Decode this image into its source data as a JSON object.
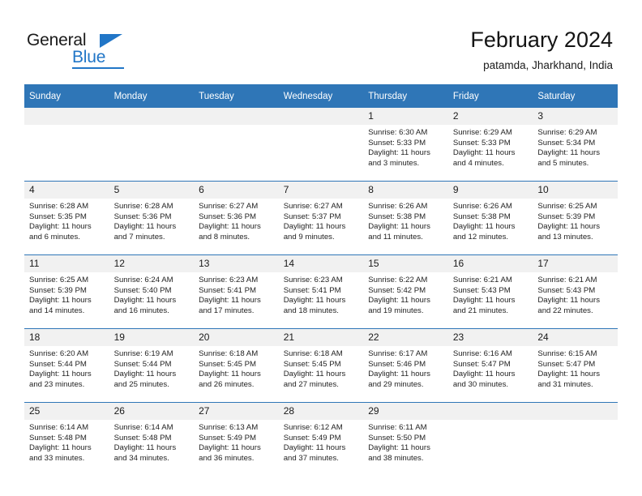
{
  "brand": {
    "name_top": "General",
    "name_bottom": "Blue",
    "accent_color": "#2176c7"
  },
  "header": {
    "title": "February 2024",
    "subtitle": "patamda, Jharkhand, India"
  },
  "theme": {
    "header_blue": "#2f76b7",
    "daynum_band": "#f1f1f1",
    "text": "#232323"
  },
  "weekday_headers": [
    "Sunday",
    "Monday",
    "Tuesday",
    "Wednesday",
    "Thursday",
    "Friday",
    "Saturday"
  ],
  "labels": {
    "sunrise_prefix": "Sunrise:",
    "sunset_prefix": "Sunset:",
    "daylight_prefix": "Daylight:"
  },
  "weeks": [
    [
      {
        "day": "",
        "lines": [
          "",
          "",
          "",
          ""
        ]
      },
      {
        "day": "",
        "lines": [
          "",
          "",
          "",
          ""
        ]
      },
      {
        "day": "",
        "lines": [
          "",
          "",
          "",
          ""
        ]
      },
      {
        "day": "",
        "lines": [
          "",
          "",
          "",
          ""
        ]
      },
      {
        "day": "1",
        "lines": [
          "Sunrise: 6:30 AM",
          "Sunset: 5:33 PM",
          "Daylight: 11 hours",
          "and 3 minutes."
        ]
      },
      {
        "day": "2",
        "lines": [
          "Sunrise: 6:29 AM",
          "Sunset: 5:33 PM",
          "Daylight: 11 hours",
          "and 4 minutes."
        ]
      },
      {
        "day": "3",
        "lines": [
          "Sunrise: 6:29 AM",
          "Sunset: 5:34 PM",
          "Daylight: 11 hours",
          "and 5 minutes."
        ]
      }
    ],
    [
      {
        "day": "4",
        "lines": [
          "Sunrise: 6:28 AM",
          "Sunset: 5:35 PM",
          "Daylight: 11 hours",
          "and 6 minutes."
        ]
      },
      {
        "day": "5",
        "lines": [
          "Sunrise: 6:28 AM",
          "Sunset: 5:36 PM",
          "Daylight: 11 hours",
          "and 7 minutes."
        ]
      },
      {
        "day": "6",
        "lines": [
          "Sunrise: 6:27 AM",
          "Sunset: 5:36 PM",
          "Daylight: 11 hours",
          "and 8 minutes."
        ]
      },
      {
        "day": "7",
        "lines": [
          "Sunrise: 6:27 AM",
          "Sunset: 5:37 PM",
          "Daylight: 11 hours",
          "and 9 minutes."
        ]
      },
      {
        "day": "8",
        "lines": [
          "Sunrise: 6:26 AM",
          "Sunset: 5:38 PM",
          "Daylight: 11 hours",
          "and 11 minutes."
        ]
      },
      {
        "day": "9",
        "lines": [
          "Sunrise: 6:26 AM",
          "Sunset: 5:38 PM",
          "Daylight: 11 hours",
          "and 12 minutes."
        ]
      },
      {
        "day": "10",
        "lines": [
          "Sunrise: 6:25 AM",
          "Sunset: 5:39 PM",
          "Daylight: 11 hours",
          "and 13 minutes."
        ]
      }
    ],
    [
      {
        "day": "11",
        "lines": [
          "Sunrise: 6:25 AM",
          "Sunset: 5:39 PM",
          "Daylight: 11 hours",
          "and 14 minutes."
        ]
      },
      {
        "day": "12",
        "lines": [
          "Sunrise: 6:24 AM",
          "Sunset: 5:40 PM",
          "Daylight: 11 hours",
          "and 16 minutes."
        ]
      },
      {
        "day": "13",
        "lines": [
          "Sunrise: 6:23 AM",
          "Sunset: 5:41 PM",
          "Daylight: 11 hours",
          "and 17 minutes."
        ]
      },
      {
        "day": "14",
        "lines": [
          "Sunrise: 6:23 AM",
          "Sunset: 5:41 PM",
          "Daylight: 11 hours",
          "and 18 minutes."
        ]
      },
      {
        "day": "15",
        "lines": [
          "Sunrise: 6:22 AM",
          "Sunset: 5:42 PM",
          "Daylight: 11 hours",
          "and 19 minutes."
        ]
      },
      {
        "day": "16",
        "lines": [
          "Sunrise: 6:21 AM",
          "Sunset: 5:43 PM",
          "Daylight: 11 hours",
          "and 21 minutes."
        ]
      },
      {
        "day": "17",
        "lines": [
          "Sunrise: 6:21 AM",
          "Sunset: 5:43 PM",
          "Daylight: 11 hours",
          "and 22 minutes."
        ]
      }
    ],
    [
      {
        "day": "18",
        "lines": [
          "Sunrise: 6:20 AM",
          "Sunset: 5:44 PM",
          "Daylight: 11 hours",
          "and 23 minutes."
        ]
      },
      {
        "day": "19",
        "lines": [
          "Sunrise: 6:19 AM",
          "Sunset: 5:44 PM",
          "Daylight: 11 hours",
          "and 25 minutes."
        ]
      },
      {
        "day": "20",
        "lines": [
          "Sunrise: 6:18 AM",
          "Sunset: 5:45 PM",
          "Daylight: 11 hours",
          "and 26 minutes."
        ]
      },
      {
        "day": "21",
        "lines": [
          "Sunrise: 6:18 AM",
          "Sunset: 5:45 PM",
          "Daylight: 11 hours",
          "and 27 minutes."
        ]
      },
      {
        "day": "22",
        "lines": [
          "Sunrise: 6:17 AM",
          "Sunset: 5:46 PM",
          "Daylight: 11 hours",
          "and 29 minutes."
        ]
      },
      {
        "day": "23",
        "lines": [
          "Sunrise: 6:16 AM",
          "Sunset: 5:47 PM",
          "Daylight: 11 hours",
          "and 30 minutes."
        ]
      },
      {
        "day": "24",
        "lines": [
          "Sunrise: 6:15 AM",
          "Sunset: 5:47 PM",
          "Daylight: 11 hours",
          "and 31 minutes."
        ]
      }
    ],
    [
      {
        "day": "25",
        "lines": [
          "Sunrise: 6:14 AM",
          "Sunset: 5:48 PM",
          "Daylight: 11 hours",
          "and 33 minutes."
        ]
      },
      {
        "day": "26",
        "lines": [
          "Sunrise: 6:14 AM",
          "Sunset: 5:48 PM",
          "Daylight: 11 hours",
          "and 34 minutes."
        ]
      },
      {
        "day": "27",
        "lines": [
          "Sunrise: 6:13 AM",
          "Sunset: 5:49 PM",
          "Daylight: 11 hours",
          "and 36 minutes."
        ]
      },
      {
        "day": "28",
        "lines": [
          "Sunrise: 6:12 AM",
          "Sunset: 5:49 PM",
          "Daylight: 11 hours",
          "and 37 minutes."
        ]
      },
      {
        "day": "29",
        "lines": [
          "Sunrise: 6:11 AM",
          "Sunset: 5:50 PM",
          "Daylight: 11 hours",
          "and 38 minutes."
        ]
      },
      {
        "day": "",
        "lines": [
          "",
          "",
          "",
          ""
        ]
      },
      {
        "day": "",
        "lines": [
          "",
          "",
          "",
          ""
        ]
      }
    ]
  ]
}
